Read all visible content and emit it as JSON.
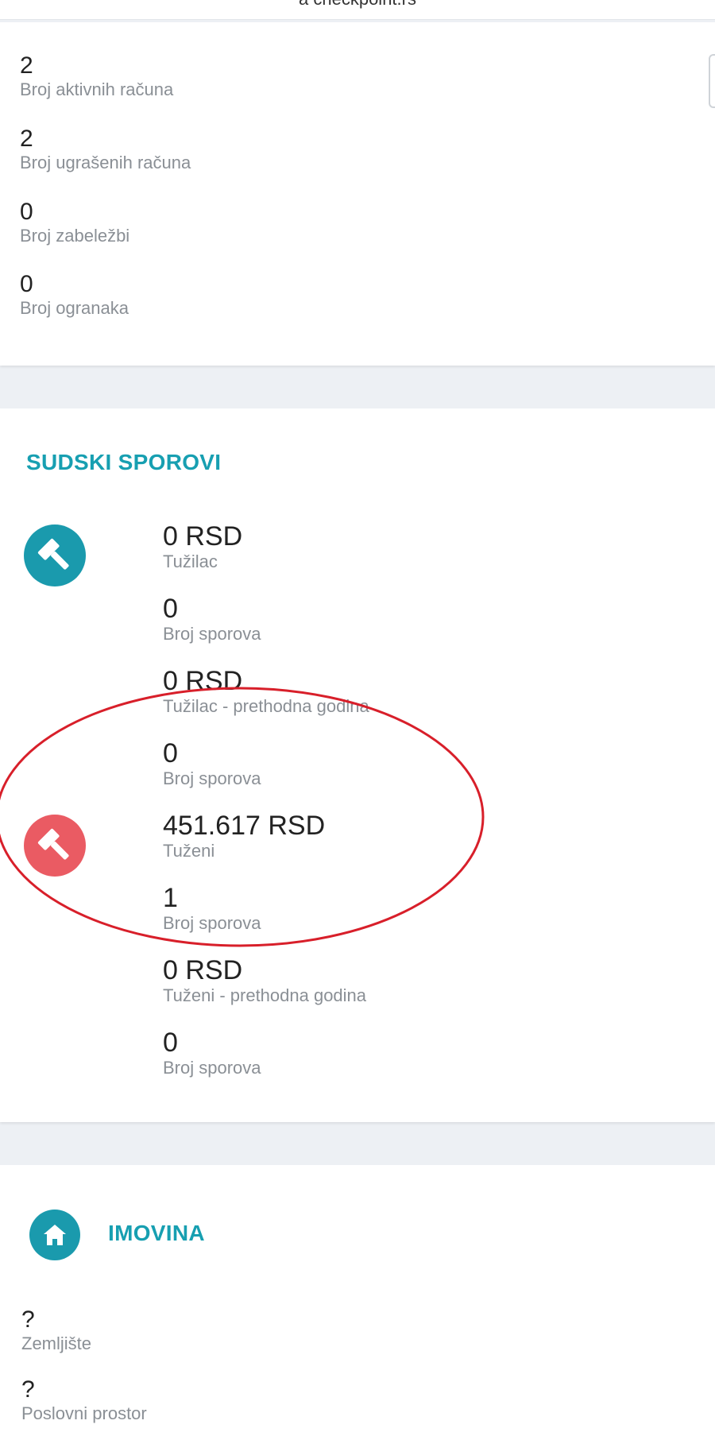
{
  "topbar": {
    "text": "a checkpoint.rs"
  },
  "stats": [
    {
      "value": "2",
      "label": "Broj aktivnih računa"
    },
    {
      "value": "2",
      "label": "Broj ugrašenih računa"
    },
    {
      "value": "0",
      "label": "Broj zabeležbi"
    },
    {
      "value": "0",
      "label": "Broj ogranaka"
    }
  ],
  "sudski_sporovi": {
    "title": "SUDSKI SPOROVI",
    "plaintiff_icon": "gavel-icon",
    "defendant_icon": "gavel-icon",
    "items": [
      {
        "value": "0 RSD",
        "label": "Tužilac"
      },
      {
        "value": "0",
        "label": "Broj sporova"
      },
      {
        "value": "0 RSD",
        "label": "Tužilac - prethodna godina"
      },
      {
        "value": "0",
        "label": "Broj sporova"
      },
      {
        "value": "451.617 RSD",
        "label": "Tuženi"
      },
      {
        "value": "1",
        "label": "Broj sporova"
      },
      {
        "value": "0 RSD",
        "label": "Tuženi - prethodna godina"
      },
      {
        "value": "0",
        "label": "Broj sporova"
      }
    ]
  },
  "imovina": {
    "title": "IMOVINA",
    "icon": "home-icon",
    "items": [
      {
        "value": "?",
        "label": "Zemljište"
      },
      {
        "value": "?",
        "label": "Poslovni prostor"
      }
    ]
  },
  "colors": {
    "accent": "#179fb1",
    "plaintiff": "#1a9aad",
    "defendant": "#ea5b63",
    "annotation": "#d81f2a"
  }
}
